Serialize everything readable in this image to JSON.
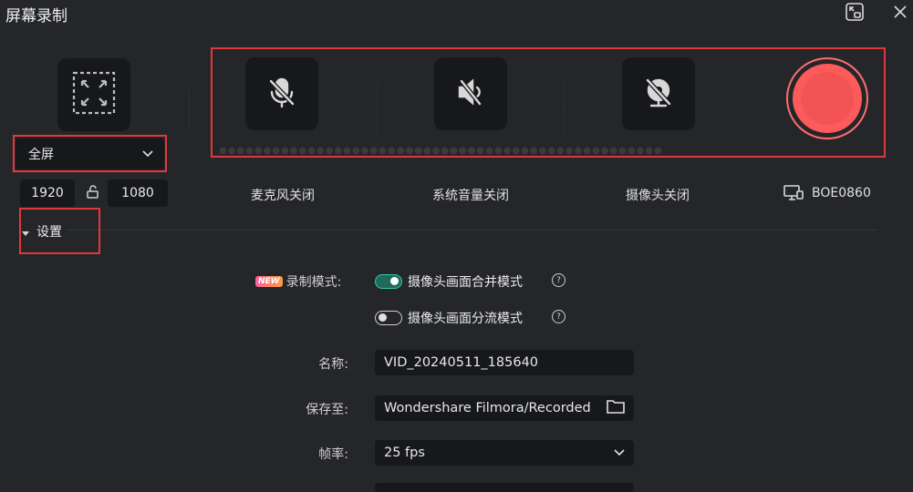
{
  "window": {
    "title": "屏幕录制",
    "minimize_icon": "picture-in-picture-icon",
    "close_icon": "close-icon"
  },
  "capture": {
    "area_icon": "fullscreen-expand-icon",
    "area_select": "全屏",
    "width": "1920",
    "height": "1080",
    "lock_icon": "unlocked-aspect-icon"
  },
  "devices": {
    "mic_label": "麦克风关闭",
    "system_audio_label": "系统音量关闭",
    "camera_label": "摄像头关闭",
    "monitor_label": "BOE0860",
    "mic_icon": "mic-off-icon",
    "speaker_icon": "speaker-off-icon",
    "camera_icon": "camera-off-icon",
    "monitor_icon": "monitor-icon"
  },
  "record_button_color": "#fd5b5b",
  "settings": {
    "header": "设置",
    "record_mode_label": "录制模式:",
    "new_badge": "NEW",
    "mode_merge": "摄像头画面合并模式",
    "mode_merge_on": true,
    "mode_split": "摄像头画面分流模式",
    "mode_split_on": false,
    "help_glyph": "?",
    "name_label": "名称:",
    "name_value": "VID_20240511_185640",
    "save_label": "保存至:",
    "save_value": "Wondershare Filmora/Recorded",
    "fps_label": "帧率:",
    "fps_value": "25 fps"
  },
  "colors": {
    "highlight_red": "#e1383c",
    "toggle_accent": "#36c9a7"
  }
}
